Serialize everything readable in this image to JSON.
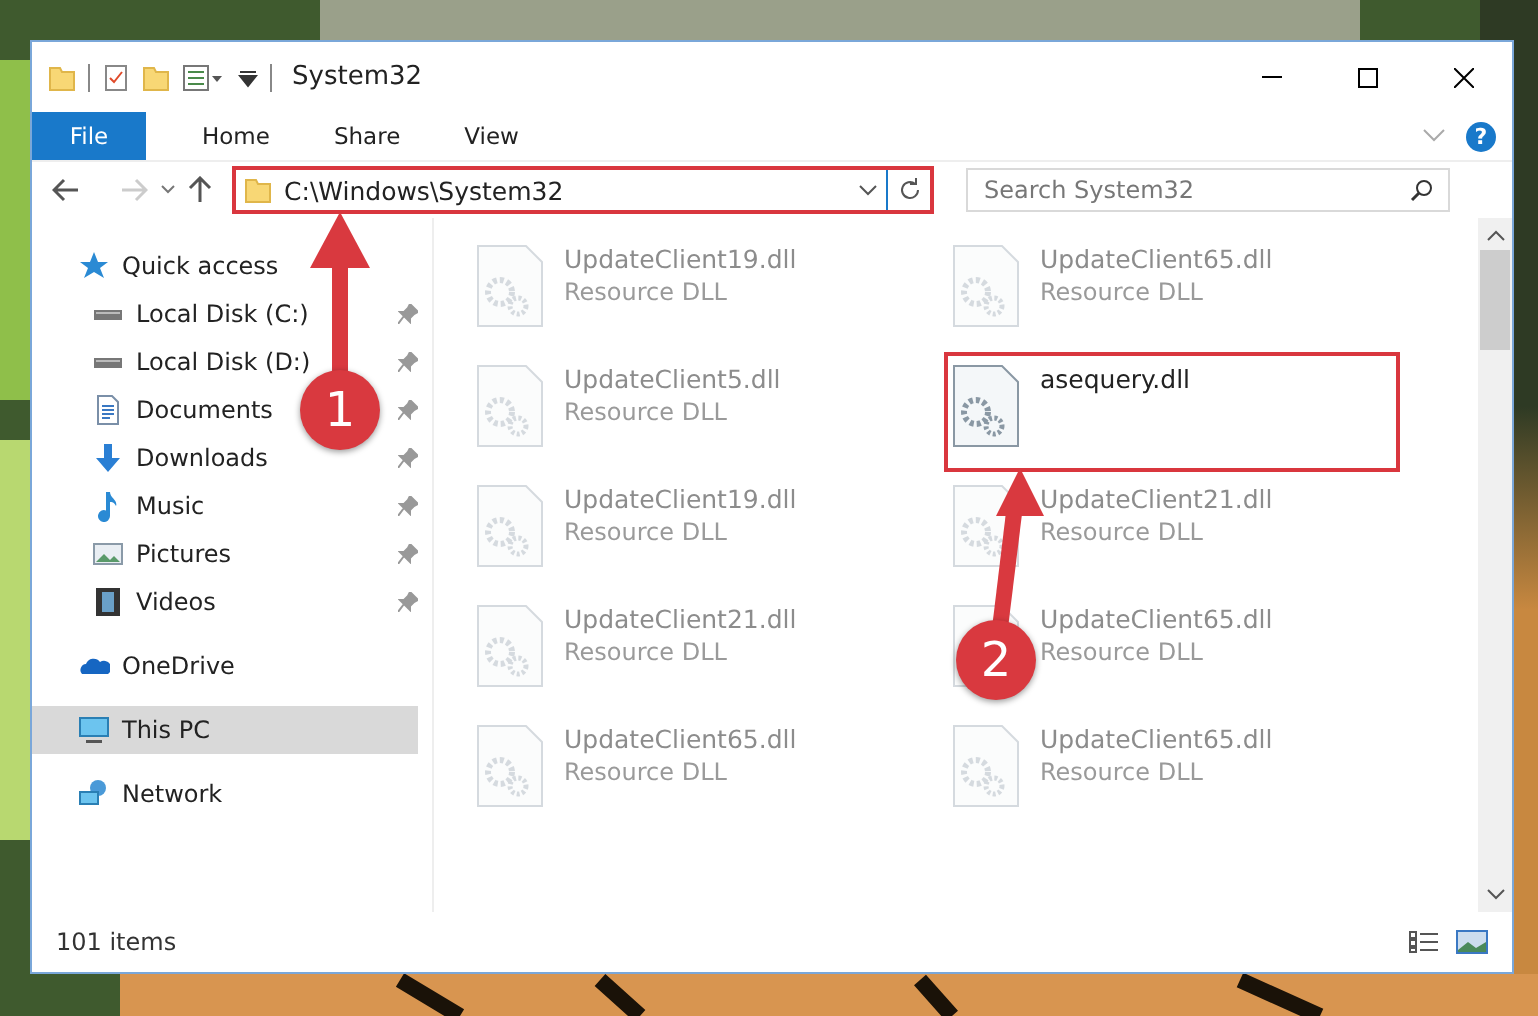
{
  "window": {
    "title": "System32",
    "help": "?"
  },
  "ribbon_tabs": [
    {
      "label": "File",
      "kind": "file"
    },
    {
      "label": "Home",
      "kind": "tab"
    },
    {
      "label": "Share",
      "kind": "tab"
    },
    {
      "label": "View",
      "kind": "tab"
    }
  ],
  "address": {
    "path": "C:\\Windows\\System32",
    "highlighted": true
  },
  "search": {
    "placeholder": "Search System32"
  },
  "nav": [
    {
      "label": "Quick access",
      "kind": "star",
      "selected": false,
      "children": [
        {
          "label": "Local Disk (C:)",
          "kind": "drive",
          "pinned": true,
          "selected": false
        },
        {
          "label": "Local Disk (D:)",
          "kind": "drive",
          "pinned": true,
          "selected": false
        },
        {
          "label": "Documents",
          "kind": "docs",
          "pinned": true,
          "selected": false
        },
        {
          "label": "Downloads",
          "kind": "downloads",
          "pinned": true,
          "selected": false
        },
        {
          "label": "Music",
          "kind": "music",
          "pinned": true,
          "selected": false
        },
        {
          "label": "Pictures",
          "kind": "pictures",
          "pinned": true,
          "selected": false
        },
        {
          "label": "Videos",
          "kind": "videos",
          "pinned": true,
          "selected": false
        }
      ]
    },
    {
      "label": "OneDrive",
      "kind": "cloud",
      "selected": false
    },
    {
      "label": "This PC",
      "kind": "pc",
      "selected": true
    },
    {
      "label": "Network",
      "kind": "network",
      "selected": false
    }
  ],
  "files": [
    {
      "name": "UpdateClient19.dll",
      "type": "Resource DLL",
      "faded": true,
      "highlighted": false
    },
    {
      "name": "UpdateClient65.dll",
      "type": "Resource DLL",
      "faded": true,
      "highlighted": false
    },
    {
      "name": "UpdateClient5.dll",
      "type": "Resource DLL",
      "faded": true,
      "highlighted": false
    },
    {
      "name": "asequery.dll",
      "faded": false,
      "highlighted": true
    },
    {
      "name": "UpdateClient19.dll",
      "type": "Resource DLL",
      "faded": true,
      "highlighted": false
    },
    {
      "name": "UpdateClient21.dll",
      "type": "Resource DLL",
      "faded": true,
      "highlighted": false
    },
    {
      "name": "UpdateClient21.dll",
      "type": "Resource DLL",
      "faded": true,
      "highlighted": false
    },
    {
      "name": "UpdateClient65.dll",
      "type": "Resource DLL",
      "faded": true,
      "highlighted": false
    },
    {
      "name": "UpdateClient65.dll",
      "type": "Resource DLL",
      "faded": true,
      "highlighted": false
    },
    {
      "name": "UpdateClient65.dll",
      "type": "Resource DLL",
      "faded": true,
      "highlighted": false
    }
  ],
  "status_bar": {
    "count": "101 items"
  },
  "callouts": [
    {
      "label": "1"
    },
    {
      "label": "2"
    }
  ]
}
